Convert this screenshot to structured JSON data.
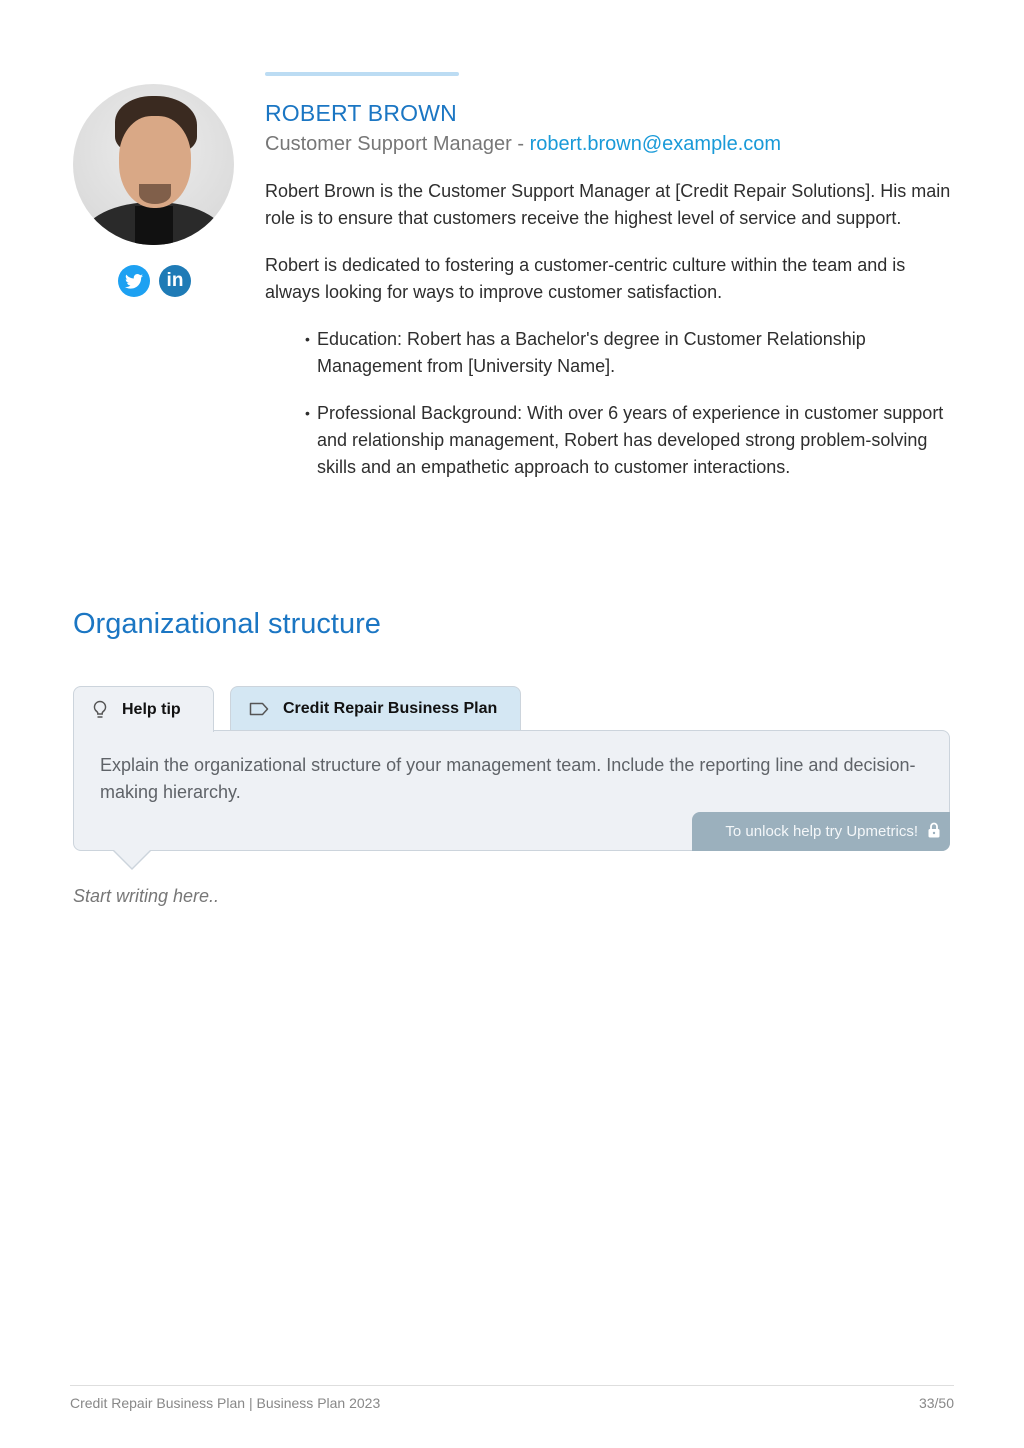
{
  "profile": {
    "name": "ROBERT BROWN",
    "title": "Customer Support Manager",
    "separator": " - ",
    "email": "robert.brown@example.com",
    "bio": [
      "Robert Brown is the Customer Support Manager at [Credit Repair Solutions]. His main role is to ensure that customers receive the highest level of service and support.",
      "Robert is dedicated to fostering a customer-centric culture within the team and is always looking for ways to improve customer satisfaction."
    ],
    "bullets": [
      "Education: Robert has a Bachelor's degree in Customer Relationship Management from [University Name].",
      "Professional Background: With over 6 years of experience in customer support and relationship management, Robert has developed strong problem-solving skills and an empathetic approach to customer interactions."
    ],
    "social": {
      "twitter_glyph": "🐦",
      "linkedin_glyph": "in"
    }
  },
  "section": {
    "title": "Organizational structure",
    "tabs": [
      {
        "label": "Help tip",
        "icon": "lightbulb-icon"
      },
      {
        "label": "Credit Repair Business Plan",
        "icon": "tag-icon"
      }
    ],
    "help_text": "Explain the organizational structure of your management team. Include the reporting line and decision-making hierarchy.",
    "unlock_label": "To unlock help try Upmetrics!",
    "placeholder": "Start writing here.."
  },
  "footer": {
    "left": "Credit Repair Business Plan | Business Plan 2023",
    "page": "33/50"
  },
  "colors": {
    "accent": "#1b76c3",
    "link": "#199ad8",
    "twitter": "#1da1f2",
    "linkedin": "#1f7bb6",
    "unlock_bg": "#9bb0bd"
  }
}
